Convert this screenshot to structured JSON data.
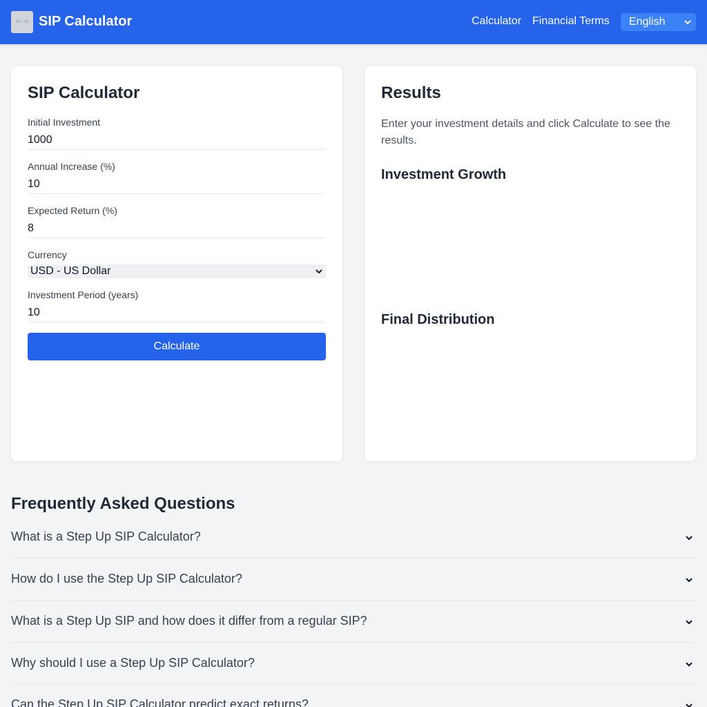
{
  "header": {
    "logo_text": "40 x 40",
    "title": "SIP Calculator",
    "nav": [
      "Calculator",
      "Financial Terms"
    ],
    "language": "English"
  },
  "calculator": {
    "title": "SIP Calculator",
    "fields": [
      {
        "label": "Initial Investment",
        "value": "1000"
      },
      {
        "label": "Annual Increase (%)",
        "value": "10"
      },
      {
        "label": "Expected Return (%)",
        "value": "8"
      },
      {
        "label": "Currency",
        "value": "USD - US Dollar"
      },
      {
        "label": "Investment Period (years)",
        "value": "10"
      }
    ],
    "button": "Calculate"
  },
  "results": {
    "title": "Results",
    "message": "Enter your investment details and click Calculate to see the results.",
    "growth_title": "Investment Growth",
    "distribution_title": "Final Distribution"
  },
  "faq": {
    "title": "Frequently Asked Questions",
    "questions": [
      "What is a Step Up SIP Calculator?",
      "How do I use the Step Up SIP Calculator?",
      "What is a Step Up SIP and how does it differ from a regular SIP?",
      "Why should I use a Step Up SIP Calculator?",
      "Can the Step Up SIP Calculator predict exact returns?"
    ]
  },
  "icons": {
    "dropdown": "chevron-down-icon"
  },
  "colors": {
    "primary": "#2563eb",
    "background": "#f3f4f6"
  }
}
